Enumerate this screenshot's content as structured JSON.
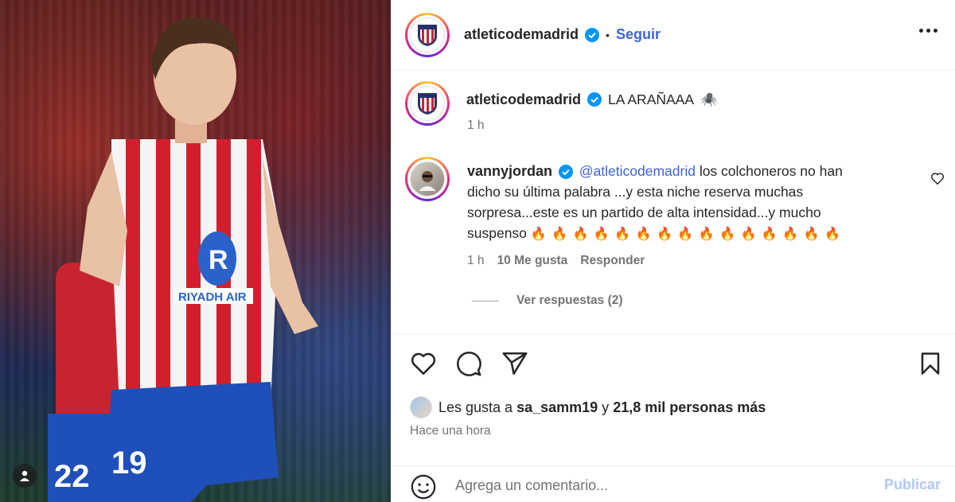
{
  "post": {
    "account": "atleticodemadrid",
    "follow_label": "Seguir",
    "separator": "•"
  },
  "caption": {
    "username": "atleticodemadrid",
    "text": "LA ARAÑAAA",
    "emoji": "🕷️",
    "time": "1 h"
  },
  "comment": {
    "username": "vannyjordan",
    "mention": "@atleticodemadrid",
    "text_line1": " los colchoneros no han",
    "text_line2": "dicho su última palabra ...y esta niche reserva muchas",
    "text_line3": "sorpresa...este es un partido de alta intensidad...y mucho",
    "text_line4": "suspenso",
    "fire_emojis": "🔥 🔥 🔥 🔥 🔥 🔥 🔥 🔥 🔥 🔥 🔥 🔥 🔥 🔥 🔥",
    "time": "1 h",
    "likes": "10 Me gusta",
    "reply_label": "Responder",
    "view_replies": "Ver respuestas (2)"
  },
  "likes": {
    "prefix": "Les gusta a ",
    "user": "sa_samm19",
    "middle": " y ",
    "count": "21,8 mil personas más"
  },
  "timestamp": "Hace una hora",
  "add_comment": {
    "placeholder": "Agrega un comentario...",
    "publish_label": "Publicar"
  },
  "colors": {
    "link": "#3f63d9",
    "verified": "#0095f6",
    "muted": "#737373",
    "publish_disabled": "#b2c7f5"
  },
  "icons": [
    "verified-badge-icon",
    "more-options-icon",
    "heart-icon",
    "comment-icon",
    "share-icon",
    "bookmark-icon",
    "emoji-icon",
    "user-tag-icon",
    "club-crest-icon"
  ]
}
